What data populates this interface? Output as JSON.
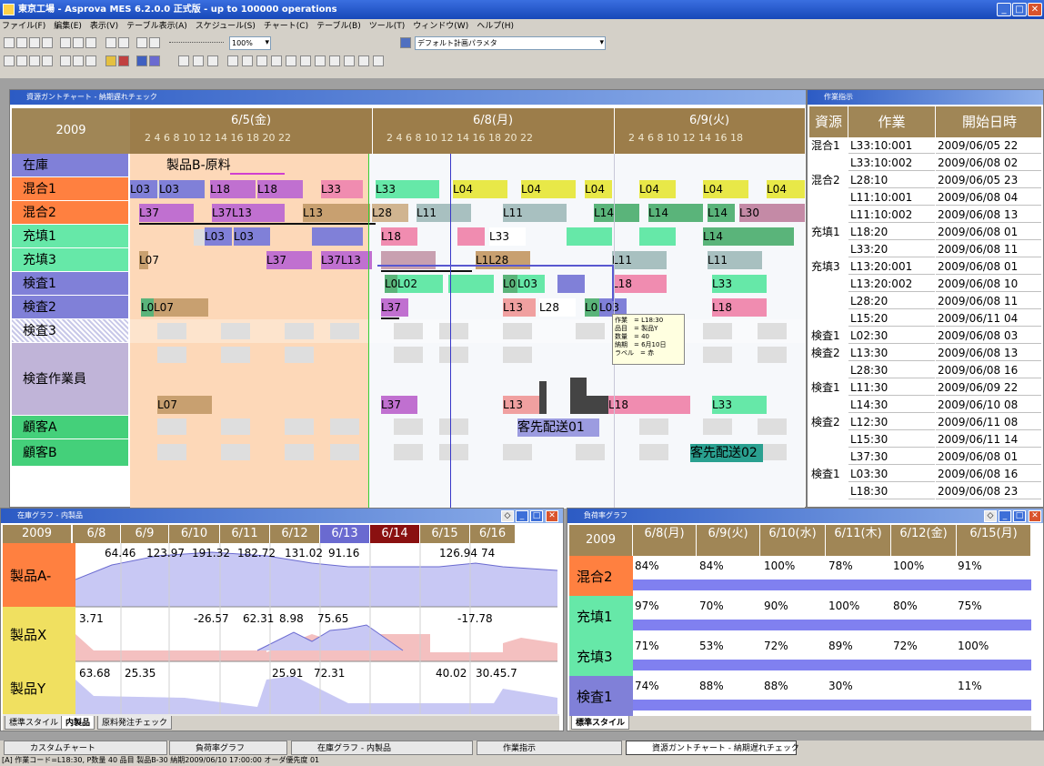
{
  "app": {
    "title": "東京工場 - Asprova MES 6.2.0.0 正式版 - up to 100000 operations"
  },
  "menu": [
    "ファイル(F)",
    "編集(E)",
    "表示(V)",
    "テーブル表示(A)",
    "スケジュール(S)",
    "チャート(C)",
    "テーブル(B)",
    "ツール(T)",
    "ウィンドウ(W)",
    "ヘルプ(H)"
  ],
  "toolbar": {
    "zoom": "100%",
    "param_combo": "デフォルト計画パラメタ"
  },
  "gantt": {
    "title": "資源ガントチャート - 納期遅れチェック",
    "year": "2009",
    "dates": [
      "6/5(金)",
      "6/8(月)",
      "6/9(火)"
    ],
    "ticks": [
      "2  4  6  8  10 12 14 16 18 20 22",
      "2  4  6  8  10 12 14 16 18 20 22",
      "2  4  6  8  10 12 14 16 18"
    ],
    "rows": [
      {
        "label": "在庫",
        "color": "#8080d8"
      },
      {
        "label": "混合1",
        "color": "#ff8040"
      },
      {
        "label": "混合2",
        "color": "#ff8040"
      },
      {
        "label": "充填1",
        "color": "#66e8a8"
      },
      {
        "label": "充填3",
        "color": "#66e8a8"
      },
      {
        "label": "検査1",
        "color": "#8080d8"
      },
      {
        "label": "検査2",
        "color": "#8080d8"
      },
      {
        "label": "検査3",
        "color": "#ffffff"
      },
      {
        "label": "検査作業員",
        "color": "#c0b4d8"
      },
      {
        "label": "顧客A",
        "color": "#44d07a"
      },
      {
        "label": "顧客B",
        "color": "#44d07a"
      }
    ],
    "labels": {
      "zaiko": "製品B-原料",
      "haisou1": "客先配送01",
      "haisou2": "客先配送02"
    },
    "tooltip": [
      "作業　= L18:30",
      "品目　= 製品Y",
      "数量　= 40",
      "納期　= 6月10日",
      "ラベル　= 赤"
    ]
  },
  "bars": {
    "mix1": [
      "L03",
      "L03",
      "L18",
      "L18",
      "L33",
      "L33",
      "L04",
      "L04",
      "L04",
      "L04",
      "L04",
      "L04"
    ],
    "mix2": [
      "L37",
      "L37L13",
      "L13",
      "L28",
      "L11",
      "L11",
      "L14",
      "L14",
      "L14",
      "L30"
    ],
    "fill1": [
      "L03",
      "L03",
      "L18",
      "L33",
      "L14"
    ],
    "fill3": [
      "L07",
      "L37",
      "L37L13",
      "L1L28",
      "L11",
      "L11"
    ],
    "insp1": [
      "L0",
      "L02",
      "L0",
      "L03",
      "L18",
      "L33"
    ],
    "insp2": [
      "L0",
      "L07",
      "L37",
      "L13",
      "L28",
      "L0",
      "L03",
      "L18"
    ],
    "worker": [
      "L07",
      "L37",
      "L13",
      "L18",
      "L33"
    ]
  },
  "table": {
    "title": "作業指示",
    "headers": [
      "資源",
      "作業",
      "開始日時"
    ],
    "rows": [
      [
        "混合1",
        "L33:10:001",
        "2009/06/05 22"
      ],
      [
        "",
        "L33:10:002",
        "2009/06/08 02"
      ],
      [
        "混合2",
        "L28:10",
        "2009/06/05 23"
      ],
      [
        "",
        "L11:10:001",
        "2009/06/08 04"
      ],
      [
        "",
        "L11:10:002",
        "2009/06/08 13"
      ],
      [
        "充填1",
        "L18:20",
        "2009/06/08 01"
      ],
      [
        "",
        "L33:20",
        "2009/06/08 11"
      ],
      [
        "充填3",
        "L13:20:001",
        "2009/06/08 01"
      ],
      [
        "",
        "L13:20:002",
        "2009/06/08 10"
      ],
      [
        "",
        "L28:20",
        "2009/06/08 11"
      ],
      [
        "",
        "L15:20",
        "2009/06/11 04"
      ],
      [
        "検査1",
        "L02:30",
        "2009/06/08 03"
      ],
      [
        "検査2",
        "L13:30",
        "2009/06/08 13"
      ],
      [
        "",
        "L28:30",
        "2009/06/08 16"
      ],
      [
        "検査1",
        "L11:30",
        "2009/06/09 22"
      ],
      [
        "",
        "L14:30",
        "2009/06/10 08"
      ],
      [
        "検査2",
        "L12:30",
        "2009/06/11 08"
      ],
      [
        "",
        "L15:30",
        "2009/06/11 14"
      ],
      [
        "",
        "L37:30",
        "2009/06/08 01"
      ],
      [
        "検査1",
        "L03:30",
        "2009/06/08 16"
      ],
      [
        "",
        "L18:30",
        "2009/06/08 23"
      ]
    ]
  },
  "inventory": {
    "title": "在庫グラフ - 内製品",
    "year": "2009",
    "dates": [
      "6/8",
      "6/9",
      "6/10",
      "6/11",
      "6/12",
      "6/13",
      "6/14",
      "6/15",
      "6/16"
    ],
    "items": [
      "製品A-",
      "製品X",
      "製品Y"
    ],
    "a_values": [
      "64.46",
      "123.97",
      "191.32",
      "182.72",
      "131.02",
      "91.16",
      "126.94",
      "74"
    ],
    "x_values": [
      "3.71",
      "-26.57",
      "62.31",
      "8.98",
      "75.65",
      "-17.78"
    ],
    "y_values": [
      "63.68",
      "25.35",
      "25.91",
      "72.31",
      "40.02",
      "30.45.7"
    ],
    "tabs": [
      "標準スタイル",
      "内製品",
      "原料発注チェック"
    ]
  },
  "load": {
    "title": "負荷率グラフ",
    "year": "2009",
    "dates": [
      "6/8(月)",
      "6/9(火)",
      "6/10(水)",
      "6/11(木)",
      "6/12(金)",
      "6/15(月)"
    ],
    "rows": [
      {
        "label": "混合2",
        "color": "#ff8040",
        "vals": [
          "84%",
          "84%",
          "100%",
          "78%",
          "100%",
          "91%"
        ]
      },
      {
        "label": "充填1",
        "color": "#66e8a8",
        "vals": [
          "97%",
          "70%",
          "90%",
          "100%",
          "80%",
          "75%"
        ]
      },
      {
        "label": "充填3",
        "color": "#66e8a8",
        "vals": [
          "71%",
          "53%",
          "72%",
          "89%",
          "72%",
          "100%"
        ]
      },
      {
        "label": "検査1",
        "color": "#8080d8",
        "vals": [
          "74%",
          "88%",
          "88%",
          "30%",
          "",
          "11%"
        ]
      }
    ],
    "tabs": [
      "標準スタイル"
    ]
  },
  "taskbar": [
    "カスタムチャート",
    "負荷率グラフ",
    "在庫グラフ - 内製品",
    "作業指示",
    "資源ガントチャート - 納期遅れチェック"
  ],
  "status": "[A] 作業コード=L18:30, P数量 40 品目 製品B-30 納期2009/06/10 17:00:00 オーダ優先度 01"
}
